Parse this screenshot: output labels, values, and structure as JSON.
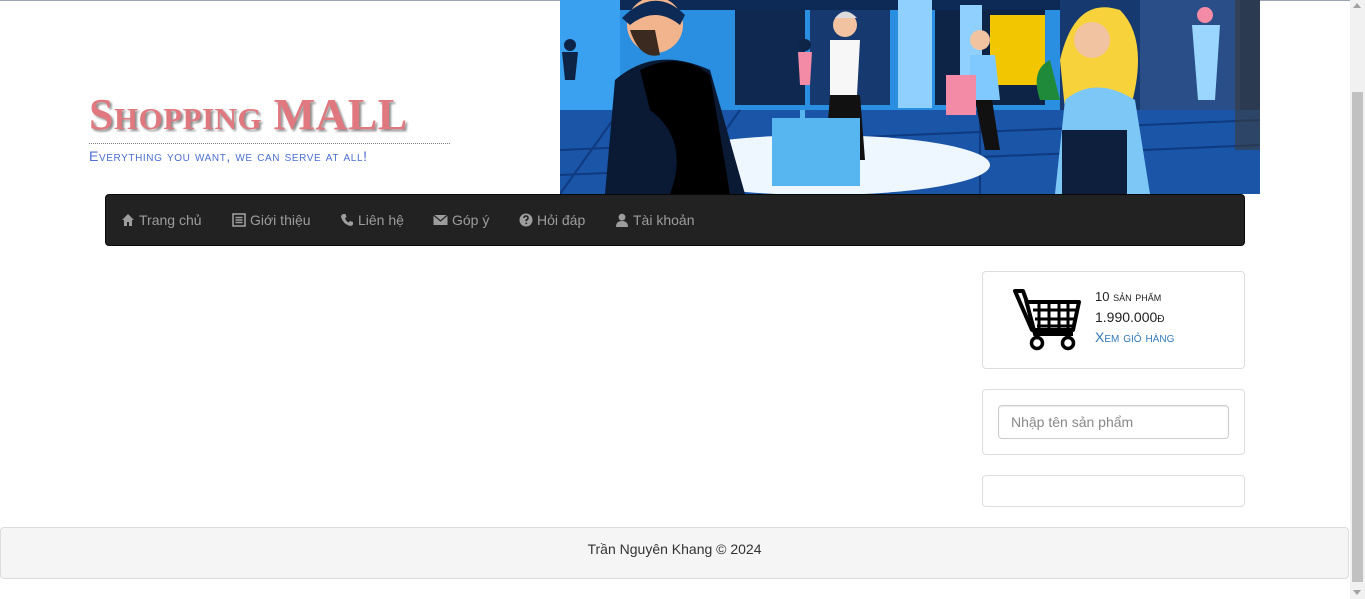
{
  "header": {
    "logo_title": "Shopping MALL",
    "logo_slogan": "Everything you want, we can serve at all!"
  },
  "nav": {
    "items": [
      {
        "label": "Trang chủ",
        "icon": "home-icon"
      },
      {
        "label": "Giới thiệu",
        "icon": "list-alt-icon"
      },
      {
        "label": "Liên hệ",
        "icon": "phone-icon"
      },
      {
        "label": "Góp ý",
        "icon": "envelope-icon"
      },
      {
        "label": "Hỏi đáp",
        "icon": "question-circle-icon"
      },
      {
        "label": "Tài khoản",
        "icon": "user-icon"
      }
    ]
  },
  "cart": {
    "count_text": "10 sản phẩm",
    "total_text": "1.990.000đ",
    "link_label": "Xem giỏ hàng",
    "icon": "shopping-cart-icon"
  },
  "search": {
    "placeholder": "Nhập tên sản phẩm",
    "value": ""
  },
  "footer": {
    "text": "Trần Nguyên Khang © 2024"
  },
  "colors": {
    "logo": "#e0787f",
    "slogan": "#4b6fd0",
    "navbar": "#222222",
    "nav_text": "#9d9d9d",
    "link": "#337ab7"
  }
}
